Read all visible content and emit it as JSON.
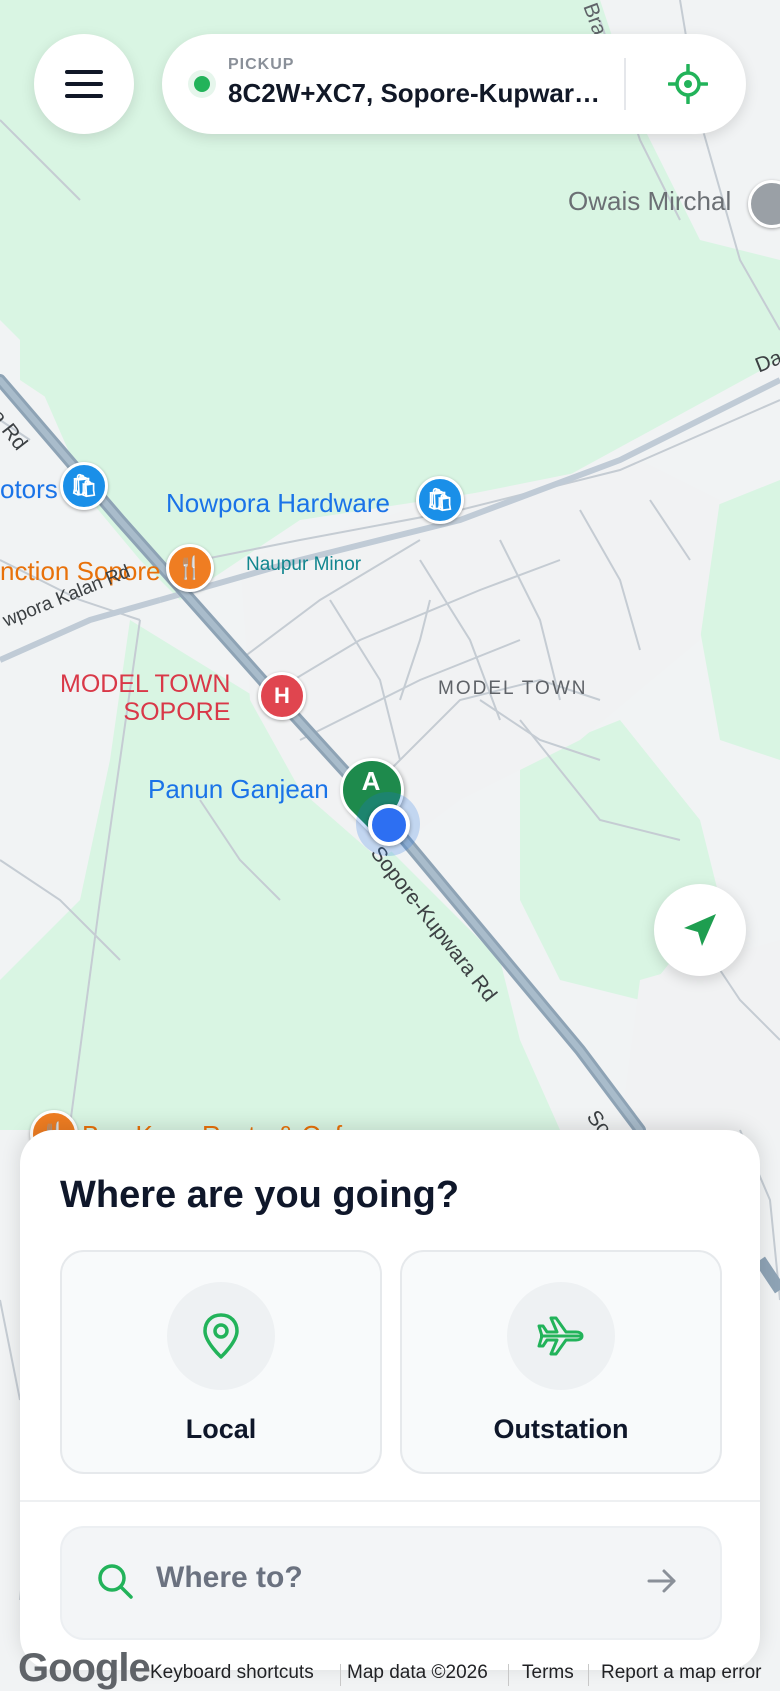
{
  "header": {
    "pickup_caption": "PICKUP",
    "pickup_address": "8C2W+XC7, Sopore-Kupwara...",
    "menu_icon": "hamburger-menu-icon",
    "locate_icon": "crosshair-icon"
  },
  "map": {
    "labels": {
      "owais": "Owais Mirchal",
      "motors": "otors",
      "nowpora_hardware": "Nowpora Hardware",
      "junction": "nction Sopore",
      "naupur": "Naupur Minor",
      "kalan_rd": "wpora Kalan Rd",
      "model_town_poi_1": "MODEL TOWN",
      "model_town_poi_2": "SOPORE",
      "model_town_area": "MODEL TOWN",
      "panun": "Panun Ganjean",
      "sopore_rd": "Sopore-Kupwara Rd",
      "rd_left": "ra Rd",
      "da_road": "Da",
      "br_road": "Bra",
      "so_road": "So",
      "bottom_cafe": "Bon Kaus Resto & Cafe",
      "marker_letter": "A",
      "hospital_letter": "H"
    },
    "colors": {
      "land": "#f1f3f4",
      "green": "#d9f5e3",
      "highway": "#8ea3b5",
      "marker_green": "#1e8a4c",
      "location_blue": "#1a73e8"
    }
  },
  "nav_button_icon": "navigation-arrow-icon",
  "sheet": {
    "title": "Where are you going?",
    "options": [
      {
        "label": "Local",
        "icon": "map-pin-icon"
      },
      {
        "label": "Outstation",
        "icon": "airplane-icon"
      }
    ],
    "search_placeholder": "Where to?"
  },
  "footer": {
    "logo": "Google",
    "keyboard": "Keyboard shortcuts",
    "mapdata": "Map data ©2026",
    "terms": "Terms",
    "report": "Report a map error"
  },
  "accent": "#22b35a"
}
